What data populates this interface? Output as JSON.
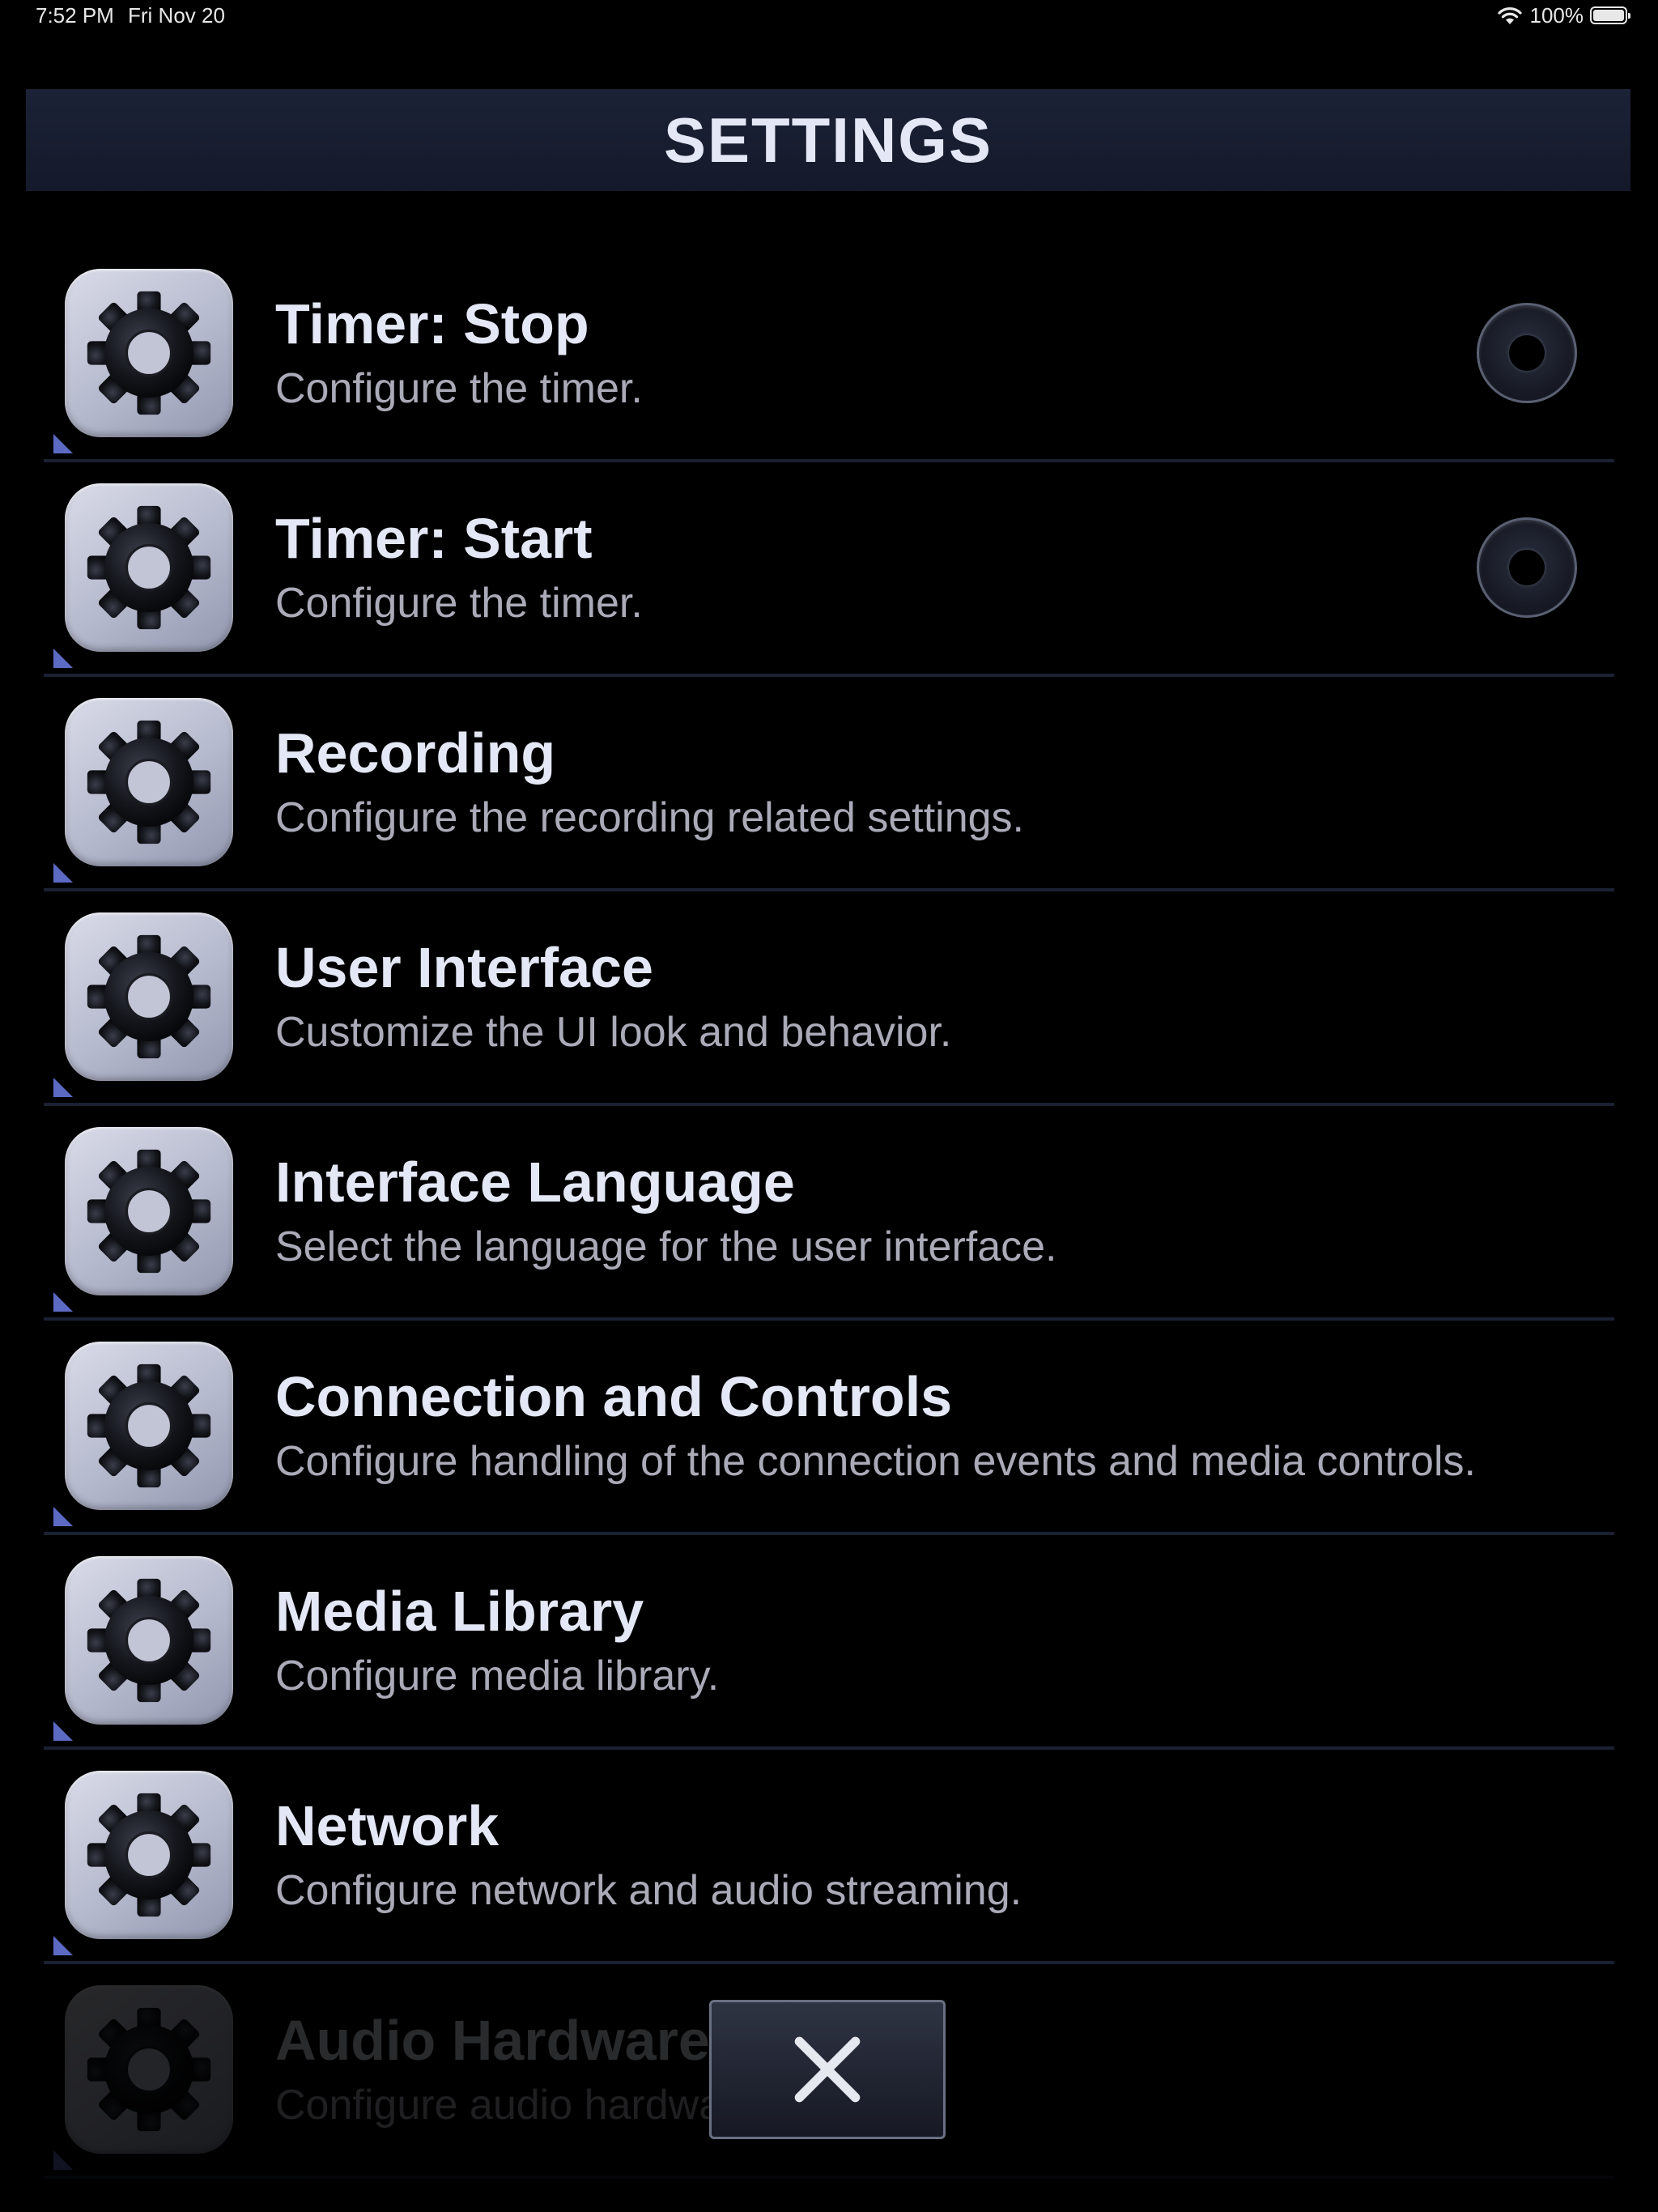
{
  "status_bar": {
    "time": "7:52 PM",
    "date": "Fri Nov 20",
    "battery": "100%"
  },
  "header": {
    "title": "SETTINGS"
  },
  "settings": [
    {
      "title": "Timer: Stop",
      "description": "Configure the timer.",
      "has_toggle": true
    },
    {
      "title": "Timer: Start",
      "description": "Configure the timer.",
      "has_toggle": true
    },
    {
      "title": "Recording",
      "description": "Configure the recording related settings.",
      "has_toggle": false
    },
    {
      "title": "User Interface",
      "description": "Customize the UI look and behavior.",
      "has_toggle": false
    },
    {
      "title": "Interface Language",
      "description": "Select the language for the user interface.",
      "has_toggle": false
    },
    {
      "title": "Connection and Controls",
      "description": "Configure handling of the connection events and media controls.",
      "has_toggle": false
    },
    {
      "title": "Media Library",
      "description": "Configure media library.",
      "has_toggle": false
    },
    {
      "title": "Network",
      "description": "Configure network and audio streaming.",
      "has_toggle": false
    },
    {
      "title": "Audio Hardware",
      "description": "Configure audio hardware.",
      "has_toggle": false
    }
  ],
  "icons": {
    "item": "gear-icon",
    "close": "close-icon"
  }
}
